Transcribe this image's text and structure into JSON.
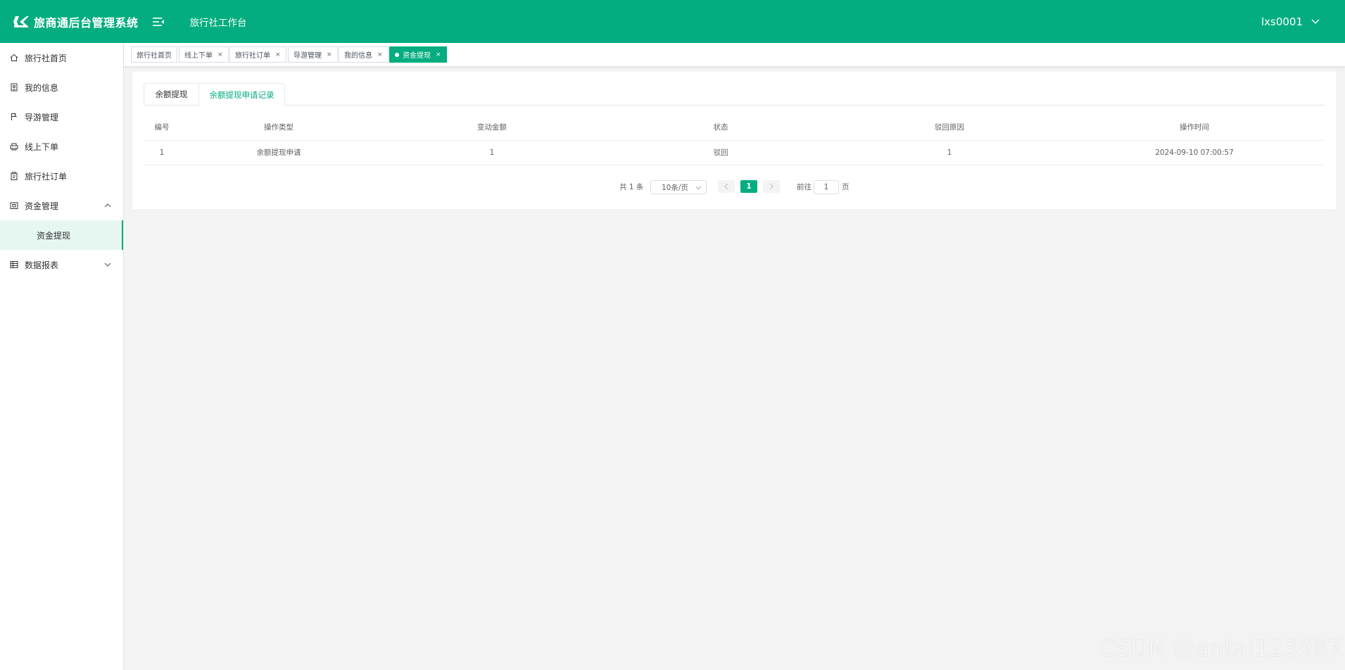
{
  "header": {
    "brand": "旅商通后台管理系统",
    "title": "旅行社工作台",
    "user": "lxs0001"
  },
  "sidebar": {
    "items": [
      {
        "label": "旅行社首页",
        "icon": "home-icon"
      },
      {
        "label": "我的信息",
        "icon": "profile-icon"
      },
      {
        "label": "导游管理",
        "icon": "flag-icon"
      },
      {
        "label": "线上下单",
        "icon": "printer-icon"
      },
      {
        "label": "旅行社订单",
        "icon": "clipboard-icon"
      },
      {
        "label": "资金管理",
        "icon": "wallet-icon",
        "expanded": true
      },
      {
        "label": "数据报表",
        "icon": "table-icon",
        "expanded": false
      }
    ],
    "sub_active": "资金提现"
  },
  "tags": [
    {
      "label": "旅行社首页",
      "closable": false
    },
    {
      "label": "线上下单",
      "closable": true
    },
    {
      "label": "旅行社订单",
      "closable": true
    },
    {
      "label": "导游管理",
      "closable": true
    },
    {
      "label": "我的信息",
      "closable": true
    },
    {
      "label": "资金提现",
      "closable": true,
      "active": true
    }
  ],
  "tag_close": "×",
  "tabs": [
    "余额提现",
    "余额提现申请记录"
  ],
  "table": {
    "columns": [
      "编号",
      "操作类型",
      "变动金额",
      "状态",
      "驳回原因",
      "操作时间"
    ],
    "rows": [
      [
        "1",
        "余额提现申请",
        "1",
        "驳回",
        "1",
        "2024-09-10 07:00:57"
      ]
    ]
  },
  "pagination": {
    "total": "共 1 条",
    "page_size": "10条/页",
    "current": "1",
    "goto_label": "前往",
    "goto_value": "1",
    "page_unit": "页"
  },
  "watermark": "CSDN @antai123987",
  "colors": {
    "accent": "#03ad7f"
  }
}
